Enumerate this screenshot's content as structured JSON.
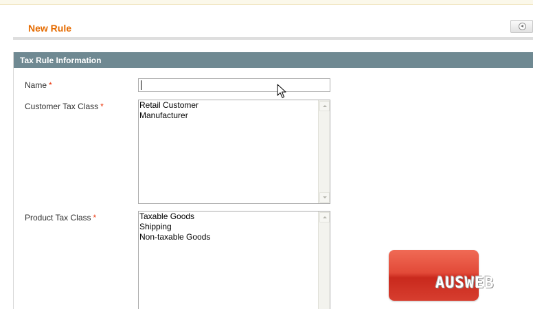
{
  "page": {
    "title": "New Rule",
    "back_button_label": ""
  },
  "section": {
    "title": "Tax Rule Information"
  },
  "form": {
    "name": {
      "label": "Name",
      "required_mark": "*",
      "value": ""
    },
    "customer_tax_class": {
      "label": "Customer Tax Class",
      "required_mark": "*",
      "options": [
        "Retail Customer",
        "Manufacturer"
      ]
    },
    "product_tax_class": {
      "label": "Product Tax Class",
      "required_mark": "*",
      "options": [
        "Taxable Goods",
        "Shipping",
        "Non-taxable Goods"
      ]
    }
  },
  "watermark": {
    "text": "AUSWEB"
  },
  "colors": {
    "title_orange": "#e56b00",
    "section_header": "#6f8992",
    "required_red": "#eb340a",
    "logo_red": "#e24a38"
  },
  "icons": {
    "back": "circle-arrow-left-icon",
    "cursor": "mouse-pointer-icon",
    "scroll_up": "scroll-up-arrow-icon",
    "scroll_down": "scroll-down-arrow-icon"
  }
}
